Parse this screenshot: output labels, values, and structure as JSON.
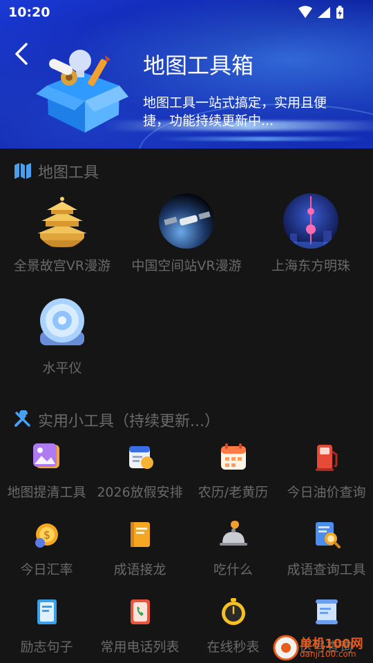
{
  "status_bar": {
    "time": "10:20"
  },
  "header": {
    "title": "地图工具箱",
    "subtitle": "地图工具一站式搞定，实用且便捷，功能持续更新中..."
  },
  "sections": {
    "map_tools": {
      "title": "地图工具",
      "items": [
        {
          "label": "全景故宫VR漫游",
          "icon": "temple-icon"
        },
        {
          "label": "中国空间站VR漫游",
          "icon": "space-station-icon"
        },
        {
          "label": "上海东方明珠",
          "icon": "oriental-pearl-tower-icon"
        },
        {
          "label": "水平仪",
          "icon": "level-gauge-icon"
        }
      ]
    },
    "utilities": {
      "title": "实用小工具（持续更新...）",
      "items": [
        {
          "label": "地图提清工具",
          "icon": "picture-icon"
        },
        {
          "label": "2026放假安排",
          "icon": "holiday-calendar-icon"
        },
        {
          "label": "农历/老黄历",
          "icon": "calendar-icon"
        },
        {
          "label": "今日油价查询",
          "icon": "fuel-pump-icon"
        },
        {
          "label": "今日汇率",
          "icon": "exchange-coin-icon"
        },
        {
          "label": "成语接龙",
          "icon": "book-icon"
        },
        {
          "label": "吃什么",
          "icon": "food-cloche-icon"
        },
        {
          "label": "成语查询工具",
          "icon": "search-document-icon"
        },
        {
          "label": "励志句子",
          "icon": "notebook-icon"
        },
        {
          "label": "常用电话列表",
          "icon": "phone-book-icon"
        },
        {
          "label": "在线秒表",
          "icon": "stopwatch-icon"
        },
        {
          "label": "区号查询",
          "icon": "area-code-scroll-icon"
        }
      ]
    }
  },
  "watermark": {
    "name": "单机100网",
    "url": "danji100.com"
  }
}
